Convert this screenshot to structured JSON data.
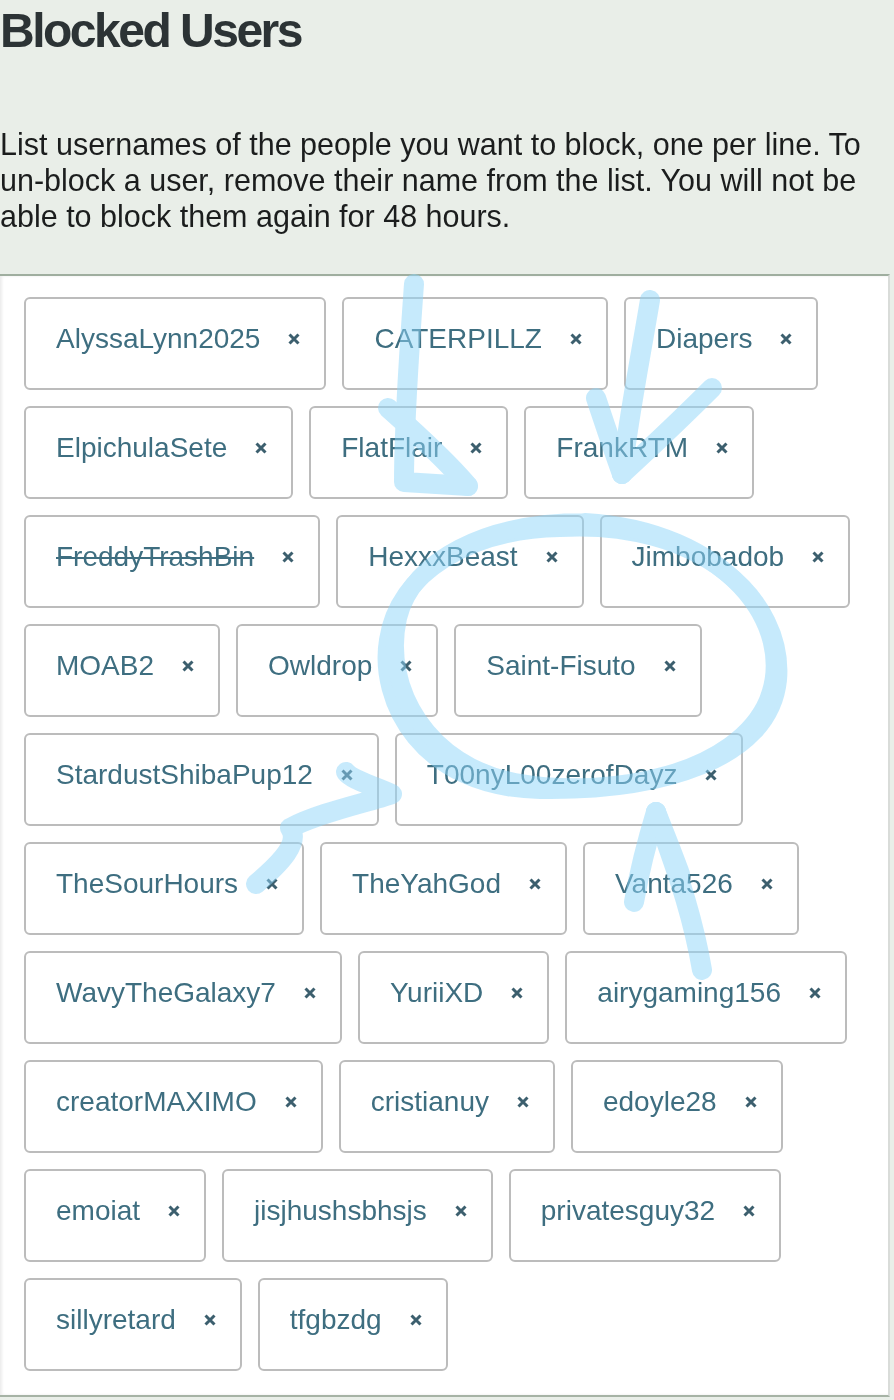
{
  "page": {
    "title": "Blocked Users",
    "description": "List usernames of the people you want to block, one per line. To un-block a user, remove their name from the list. You will not be able to block them again for 48 hours."
  },
  "blocked_users": [
    {
      "username": "AlyssaLynn2025",
      "struck_out": false
    },
    {
      "username": "CATERPILLZ",
      "struck_out": false
    },
    {
      "username": "Diapers",
      "struck_out": false
    },
    {
      "username": "ElpichulaSete",
      "struck_out": false
    },
    {
      "username": "FlatFlair",
      "struck_out": false
    },
    {
      "username": "FrankRTM",
      "struck_out": false
    },
    {
      "username": "FreddyTrashBin",
      "struck_out": true
    },
    {
      "username": "HexxxBeast",
      "struck_out": false
    },
    {
      "username": "Jimbobadob",
      "struck_out": false
    },
    {
      "username": "MOAB2",
      "struck_out": false
    },
    {
      "username": "Owldrop",
      "struck_out": false
    },
    {
      "username": "Saint-Fisuto",
      "struck_out": false
    },
    {
      "username": "StardustShibaPup12",
      "struck_out": false
    },
    {
      "username": "T00nyL00zerofDayz",
      "struck_out": false
    },
    {
      "username": "TheSourHours",
      "struck_out": false
    },
    {
      "username": "TheYahGod",
      "struck_out": false
    },
    {
      "username": "Vanta526",
      "struck_out": false
    },
    {
      "username": "WavyTheGalaxy7",
      "struck_out": false
    },
    {
      "username": "YuriiXD",
      "struck_out": false
    },
    {
      "username": "airygaming156",
      "struck_out": false
    },
    {
      "username": "creatorMAXIMO",
      "struck_out": false
    },
    {
      "username": "cristianuy",
      "struck_out": false
    },
    {
      "username": "edoyle28",
      "struck_out": false
    },
    {
      "username": "emoiat",
      "struck_out": false
    },
    {
      "username": "jisjhushsbhsjs",
      "struck_out": false
    },
    {
      "username": "privatesguy32",
      "struck_out": false
    },
    {
      "username": "sillyretard",
      "struck_out": false
    },
    {
      "username": "tfgbzdg",
      "struck_out": false
    }
  ]
}
